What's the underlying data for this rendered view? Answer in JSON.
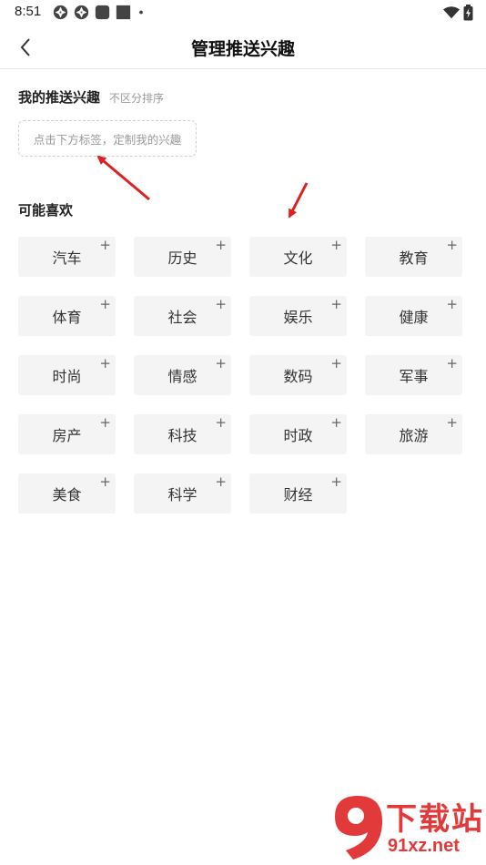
{
  "status_bar": {
    "time": "8:51",
    "left_icons": [
      "aperture-icon",
      "aperture-icon",
      "rounded-square-icon",
      "square-icon",
      "dot-icon"
    ],
    "right_icons": [
      "wifi-icon",
      "battery-charging-icon"
    ]
  },
  "nav": {
    "title": "管理推送兴趣",
    "back_icon": "chevron-left-icon"
  },
  "my_interests": {
    "title": "我的推送兴趣",
    "hint": "不区分排序",
    "placeholder": "点击下方标签，定制我的兴趣"
  },
  "suggestions": {
    "title": "可能喜欢",
    "plus_glyph": "+",
    "tags": [
      {
        "label": "汽车"
      },
      {
        "label": "历史"
      },
      {
        "label": "文化"
      },
      {
        "label": "教育"
      },
      {
        "label": "体育"
      },
      {
        "label": "社会"
      },
      {
        "label": "娱乐"
      },
      {
        "label": "健康"
      },
      {
        "label": "时尚"
      },
      {
        "label": "情感"
      },
      {
        "label": "数码"
      },
      {
        "label": "军事"
      },
      {
        "label": "房产"
      },
      {
        "label": "科技"
      },
      {
        "label": "时政"
      },
      {
        "label": "旅游"
      },
      {
        "label": "美食"
      },
      {
        "label": "科学"
      },
      {
        "label": "财经"
      }
    ]
  },
  "annotation_color": "#e02020",
  "watermark": {
    "logo_text": "9f",
    "title": "下载站",
    "site": "91xz.net",
    "color": "#e23a3a"
  }
}
